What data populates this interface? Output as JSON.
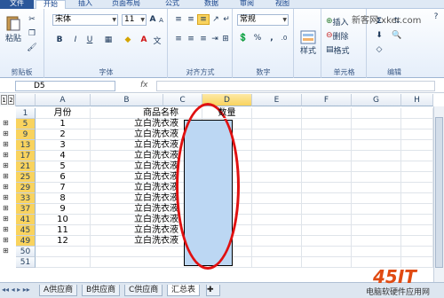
{
  "tabs": [
    "文件",
    "开始",
    "插入",
    "页面布局",
    "公式",
    "数据",
    "审阅",
    "视图"
  ],
  "ribbon": {
    "clipboard": {
      "paste": "粘贴",
      "label": "剪贴板"
    },
    "font": {
      "name": "宋体",
      "size": "11",
      "bold": "B",
      "italic": "I",
      "underline": "U",
      "grow": "A",
      "shrink": "A",
      "color": "A",
      "label": "字体"
    },
    "alignment": {
      "label": "对齐方式"
    },
    "number": {
      "format": "常规",
      "pct": "%",
      "comma": ",",
      "label": "数字"
    },
    "styles": {
      "style": "样式"
    },
    "cells": {
      "insert": "插入",
      "delete": "删除",
      "format": "格式",
      "label": "单元格"
    },
    "editing": {
      "label": "编辑"
    }
  },
  "formula_bar": {
    "name_box": "D5",
    "fx": "fx"
  },
  "columns": [
    "A",
    "B",
    "C",
    "D",
    "E",
    "F",
    "G",
    "H"
  ],
  "outline_levels": [
    "1",
    "2"
  ],
  "rows": [
    {
      "num": "1",
      "month": "月份",
      "product": "商品名称",
      "qty": "数量"
    },
    {
      "num": "5",
      "month": "1",
      "product": "立白洗衣液",
      "qty": ""
    },
    {
      "num": "9",
      "month": "2",
      "product": "立白洗衣液",
      "qty": ""
    },
    {
      "num": "13",
      "month": "3",
      "product": "立白洗衣液",
      "qty": ""
    },
    {
      "num": "17",
      "month": "4",
      "product": "立白洗衣液",
      "qty": ""
    },
    {
      "num": "21",
      "month": "5",
      "product": "立白洗衣液",
      "qty": ""
    },
    {
      "num": "25",
      "month": "6",
      "product": "立白洗衣液",
      "qty": ""
    },
    {
      "num": "29",
      "month": "7",
      "product": "立白洗衣液",
      "qty": ""
    },
    {
      "num": "33",
      "month": "8",
      "product": "立白洗衣液",
      "qty": ""
    },
    {
      "num": "37",
      "month": "9",
      "product": "立白洗衣液",
      "qty": ""
    },
    {
      "num": "41",
      "month": "10",
      "product": "立白洗衣液",
      "qty": ""
    },
    {
      "num": "45",
      "month": "11",
      "product": "立白洗衣液",
      "qty": ""
    },
    {
      "num": "49",
      "month": "12",
      "product": "立白洗衣液",
      "qty": ""
    },
    {
      "num": "50",
      "month": "",
      "product": "",
      "qty": ""
    },
    {
      "num": "51",
      "month": "",
      "product": "",
      "qty": ""
    }
  ],
  "sheets": [
    "A供应商",
    "B供应商",
    "C供应商",
    "汇总表"
  ],
  "watermarks": {
    "top": "新客网 xker.com",
    "logo": "45IT",
    "bottom": "电脑软硬件应用网"
  }
}
